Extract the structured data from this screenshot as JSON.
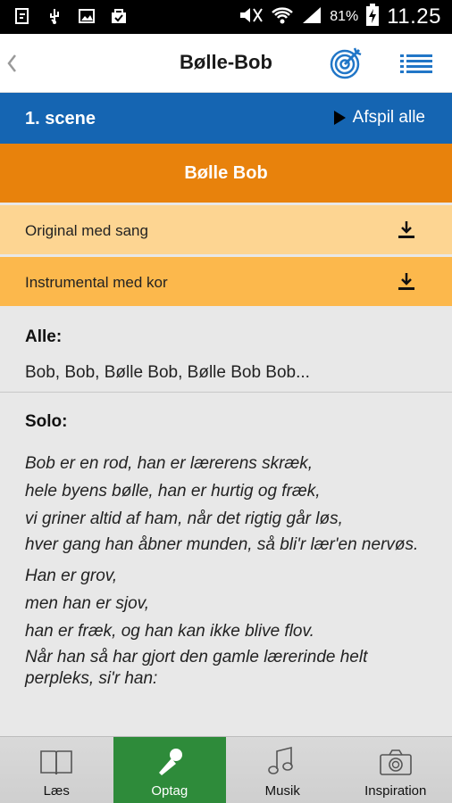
{
  "status_bar": {
    "battery_pct": "81%",
    "clock": "11.25"
  },
  "header": {
    "title": "Bølle-Bob"
  },
  "scene": {
    "title": "1. scene",
    "play_all_label": "Afspil alle"
  },
  "song": {
    "title": "Bølle Bob",
    "tracks": [
      {
        "label": "Original med sang"
      },
      {
        "label": "Instrumental med kor"
      }
    ]
  },
  "lyrics": {
    "alle_heading": "Alle:",
    "alle_text": "Bob, Bob, Bølle Bob, Bølle Bob Bob...",
    "solo_heading": "Solo:",
    "solo_lines": [
      "Bob er en rod, han er lærerens skræk,",
      "hele byens bølle, han er hurtig og fræk,",
      "vi griner altid af ham, når det rigtig går løs,",
      "hver gang han åbner munden, så bli'r lær'en nervøs.",
      "Han er grov,",
      "men han er sjov,",
      "han er fræk, og han kan ikke blive flov.",
      "Når han så har gjort den gamle lærerinde helt perpleks, si'r han:"
    ]
  },
  "tabs": [
    {
      "label": "Læs",
      "icon": "book-icon"
    },
    {
      "label": "Optag",
      "icon": "microphone-icon"
    },
    {
      "label": "Musik",
      "icon": "music-note-icon"
    },
    {
      "label": "Inspiration",
      "icon": "camera-icon"
    }
  ],
  "colors": {
    "scene_bar": "#1565b2",
    "song_bar": "#e8820c",
    "track_light": "#fdd592",
    "track_dark": "#fcb84c",
    "active_tab": "#2e8b3a"
  }
}
